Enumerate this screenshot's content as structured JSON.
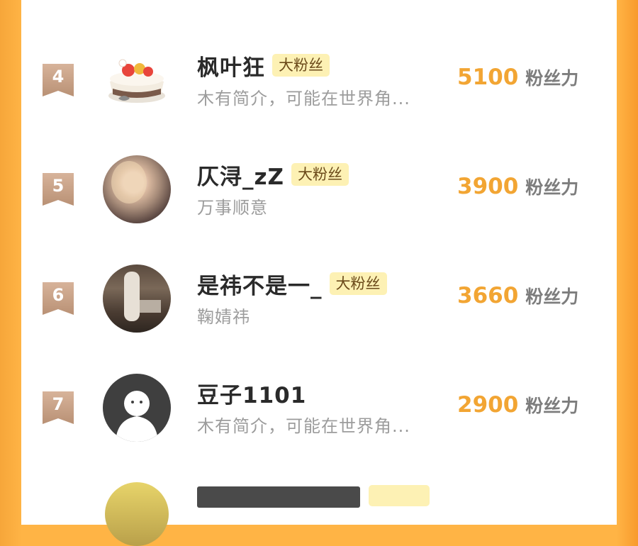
{
  "entries": [
    {
      "rank": "4",
      "name": "枫叶狂",
      "badge": "大粉丝",
      "bio": "木有简介，可能在世界角...",
      "score": "5100",
      "score_unit": "粉丝力",
      "avatar": "cake-avatar"
    },
    {
      "rank": "5",
      "name": "仄浔_zZ",
      "badge": "大粉丝",
      "bio": "万事顺意",
      "score": "3900",
      "score_unit": "粉丝力",
      "avatar": "photo-avatar"
    },
    {
      "rank": "6",
      "name": "是祎不是一_",
      "badge": "大粉丝",
      "bio": "鞠婧祎",
      "score": "3660",
      "score_unit": "粉丝力",
      "avatar": "photo-avatar"
    },
    {
      "rank": "7",
      "name": "豆子1101",
      "badge": "",
      "bio": "木有简介，可能在世界角...",
      "score": "2900",
      "score_unit": "粉丝力",
      "avatar": "default-avatar"
    }
  ],
  "colors": {
    "background": "#ffb445",
    "score": "#f2a533",
    "badge_bg": "#fdf1b4",
    "rank_ribbon": "#c9a287"
  }
}
